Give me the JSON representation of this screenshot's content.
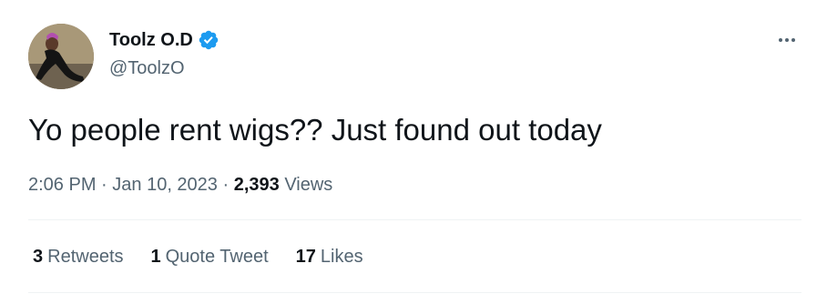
{
  "author": {
    "display_name": "Toolz O.D",
    "handle": "@ToolzO",
    "verified": true,
    "avatar_icon": "user-avatar-photo",
    "verified_color": "#1d9bf0"
  },
  "more_icon": "more-horizontal-icon",
  "tweet": {
    "text": "Yo people rent wigs?? Just found out today"
  },
  "meta": {
    "time": "2:06 PM",
    "separator1": " · ",
    "date": "Jan 10, 2023",
    "separator2": " · ",
    "views_count": "2,393",
    "views_label": " Views"
  },
  "stats": {
    "retweets_count": "3",
    "retweets_label": "Retweets",
    "quotes_count": "1",
    "quotes_label": "Quote Tweet",
    "likes_count": "17",
    "likes_label": "Likes"
  },
  "colors": {
    "text_primary": "#0f1419",
    "text_secondary": "#536471",
    "divider": "#eff3f4"
  }
}
